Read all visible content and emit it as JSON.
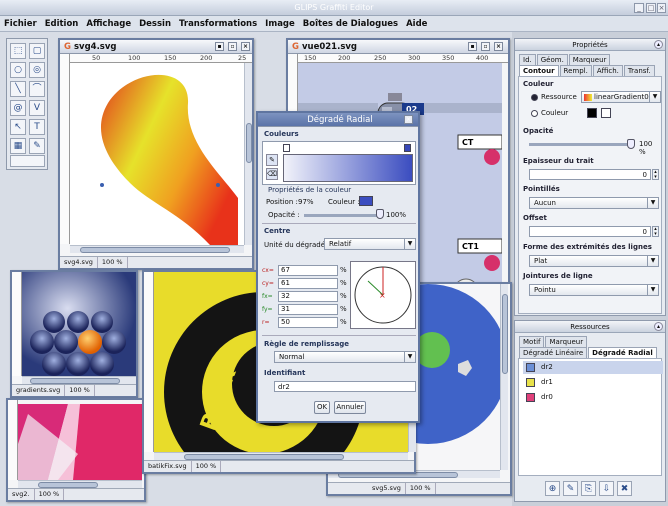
{
  "app": {
    "title": "GLIPS Graffiti Editor"
  },
  "menu": [
    "Fichier",
    "Edition",
    "Affichage",
    "Dessin",
    "Transformations",
    "Image",
    "Boîtes de Dialogues",
    "Aide"
  ],
  "windows": {
    "svg4": {
      "title": "svg4.svg",
      "ruler": [
        "50",
        "100",
        "150",
        "200",
        "25"
      ],
      "status_file": "svg4.svg",
      "status_zoom": "100 %"
    },
    "vue021": {
      "title": "vue021.svg",
      "ruler": [
        "150",
        "200",
        "250",
        "300",
        "350",
        "400"
      ],
      "labels": [
        "02",
        "CT",
        "CT1"
      ]
    },
    "gradients": {
      "status_file": "gradients.svg",
      "status_zoom": "100 %"
    },
    "svg2": {
      "status_file": "svg2.",
      "status_zoom": "100 %"
    },
    "batik": {
      "status_file": "batikFix.svg",
      "status_zoom": "100 %",
      "text": "Batik"
    },
    "svg5": {
      "status_file": "svg5.svg",
      "status_zoom": "100 %"
    }
  },
  "dialog": {
    "title": "Dégradé Radial",
    "section_colors": "Couleurs",
    "color_props": "Propriétés de la couleur",
    "position_label": "Position :",
    "position_value": "97%",
    "color_label": "Couleur :",
    "opacity_label": "Opacité :",
    "opacity_value": "100%",
    "opacity_level": 1.0,
    "section_center": "Centre",
    "unit_label": "Unité du dégradé :",
    "unit_value": "Relatif",
    "fields": [
      {
        "key": "cx=",
        "value": "67",
        "unit": "%"
      },
      {
        "key": "cy=",
        "value": "61",
        "unit": "%"
      },
      {
        "key": "fx=",
        "value": "32",
        "unit": "%"
      },
      {
        "key": "fy=",
        "value": "31",
        "unit": "%"
      },
      {
        "key": "r=",
        "value": "50",
        "unit": "%"
      }
    ],
    "fill_rule_label": "Règle de remplissage",
    "fill_rule_value": "Normal",
    "id_label": "Identifiant",
    "id_value": "dr2",
    "ok": "OK",
    "cancel": "Annuler"
  },
  "properties": {
    "title": "Propriétés",
    "tabs_top": [
      "Id.",
      "Géom.",
      "Marqueur"
    ],
    "tabs_bottom": [
      "Contour",
      "Rempl.",
      "Affich.",
      "Transf."
    ],
    "colour_label": "Couleur",
    "resource_radio": "Ressource",
    "resource_value": "linearGradient0",
    "colour_radio": "Couleur",
    "opacity_label": "Opacité",
    "opacity_value": "100 %",
    "opacity_level": 1.0,
    "stroke_width_label": "Epaisseur du trait",
    "stroke_width_value": "0",
    "dash_label": "Pointillés",
    "dash_value": "Aucun",
    "offset_label": "Offset",
    "offset_value": "0",
    "line_ends_label": "Forme des extrémités des lignes",
    "line_ends_value": "Plat",
    "joins_label": "Jointures de ligne",
    "joins_value": "Pointu"
  },
  "resources": {
    "title": "Ressources",
    "tabs_top": [
      "Motif",
      "Marqueur"
    ],
    "tabs_bottom": [
      "Dégradé Linéaire",
      "Dégradé Radial"
    ],
    "items": [
      {
        "label": "dr2",
        "color": "#6b8fd6"
      },
      {
        "label": "dr1",
        "color": "#e8e24a"
      },
      {
        "label": "dr0",
        "color": "#e0407a"
      }
    ]
  },
  "colors": {
    "accent": "#5a73a8",
    "desk": "#d8dde6"
  }
}
